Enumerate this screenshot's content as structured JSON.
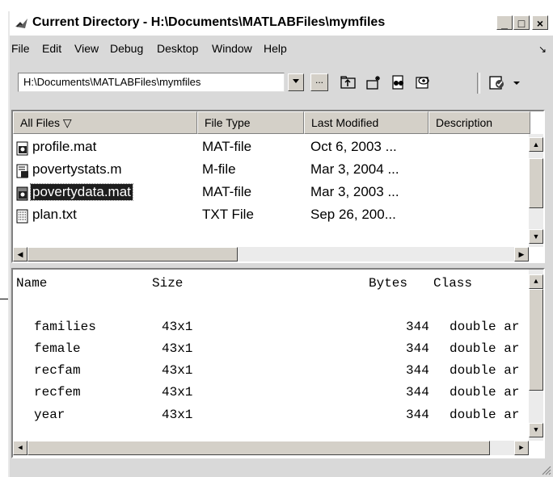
{
  "window": {
    "title": "Current Directory - H:\\Documents\\MATLABFiles\\mymfiles"
  },
  "caption_buttons": {
    "minimize": "_",
    "maximize": "□",
    "close": "×"
  },
  "menu": {
    "items": [
      "File",
      "Edit",
      "View",
      "Debug",
      "Desktop",
      "Window",
      "Help"
    ],
    "dock_symbol": "↘"
  },
  "toolbar": {
    "path_value": "H:\\Documents\\MATLABFiles\\mymfiles",
    "browse_label": "...",
    "icons": [
      "up-folder-icon",
      "new-folder-icon",
      "find-files-icon",
      "visdiff-icon",
      "reports-icon"
    ]
  },
  "file_list": {
    "columns": [
      "All Files  ▽",
      "File Type",
      "Last Modified",
      "Description"
    ],
    "rows": [
      {
        "name": "profile.mat",
        "type": "MAT-file",
        "modified": "Oct 6, 2003 ...",
        "selected": false,
        "icon": "mat-file-icon"
      },
      {
        "name": "povertystats.m",
        "type": "M-file",
        "modified": "Mar 3, 2004 ...",
        "selected": false,
        "icon": "m-file-icon"
      },
      {
        "name": "povertydata.mat",
        "type": "MAT-file",
        "modified": "Mar 3, 2003 ...",
        "selected": true,
        "icon": "mat-file-icon"
      },
      {
        "name": "plan.txt",
        "type": "TXT File",
        "modified": "Sep 26, 200...",
        "selected": false,
        "icon": "txt-file-icon"
      }
    ]
  },
  "workspace_preview": {
    "headers": {
      "name": "Name",
      "size": "Size",
      "bytes": "Bytes",
      "class": "Class"
    },
    "rows": [
      {
        "name": "families",
        "size": "43x1",
        "bytes": "344",
        "class": "double ar"
      },
      {
        "name": "female",
        "size": "43x1",
        "bytes": "344",
        "class": "double ar"
      },
      {
        "name": "recfam",
        "size": "43x1",
        "bytes": "344",
        "class": "double ar"
      },
      {
        "name": "recfem",
        "size": "43x1",
        "bytes": "344",
        "class": "double ar"
      },
      {
        "name": "year",
        "size": "43x1",
        "bytes": "344",
        "class": "double ar"
      }
    ]
  },
  "colors": {
    "selection_bg": "#1e1e1e",
    "window_bg": "#d9d9d9",
    "button_face": "#d4d0c8"
  }
}
